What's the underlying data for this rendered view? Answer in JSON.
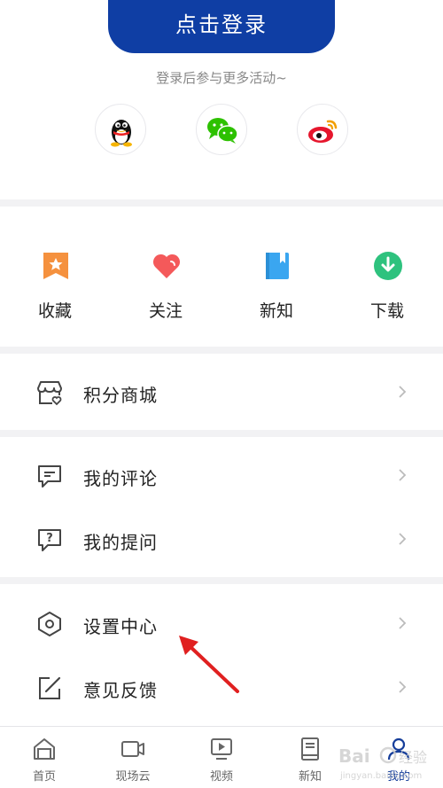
{
  "login": {
    "button_label": "点击登录",
    "hint": "登录后参与更多活动~"
  },
  "social": [
    {
      "name": "qq-icon"
    },
    {
      "name": "wechat-icon"
    },
    {
      "name": "weibo-icon"
    }
  ],
  "quick_actions": [
    {
      "label": "收藏",
      "icon": "bookmark-star-icon",
      "color": "#f5913e"
    },
    {
      "label": "关注",
      "icon": "heart-icon",
      "color": "#f4595a"
    },
    {
      "label": "新知",
      "icon": "book-icon",
      "color": "#3aa6f0"
    },
    {
      "label": "下载",
      "icon": "download-icon",
      "color": "#2ec27e"
    }
  ],
  "menu": {
    "points_mall": "积分商城",
    "my_comments": "我的评论",
    "my_questions": "我的提问",
    "settings": "设置中心",
    "feedback": "意见反馈"
  },
  "tabs": [
    {
      "label": "首页",
      "icon": "home-icon",
      "active": false
    },
    {
      "label": "现场云",
      "icon": "video-camera-icon",
      "active": false
    },
    {
      "label": "视频",
      "icon": "video-icon",
      "active": false
    },
    {
      "label": "新知",
      "icon": "book-icon",
      "active": false
    },
    {
      "label": "我的",
      "icon": "user-icon",
      "active": true
    }
  ],
  "colors": {
    "brand": "#0f3ea4",
    "active_tab": "#163e9a",
    "annotation_arrow": "#e02020"
  },
  "watermark": "Baidu经验"
}
